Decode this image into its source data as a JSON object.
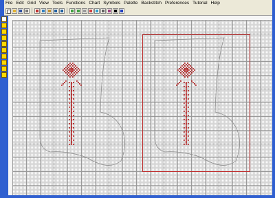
{
  "menu": [
    "File",
    "Edit",
    "Grid",
    "View",
    "Tools",
    "Functions",
    "Chart",
    "Symbols",
    "Palette",
    "Backstitch",
    "Preferences",
    "Tutorial",
    "Help"
  ],
  "toolbar": {
    "buttons": [
      "new-icon",
      "open-icon",
      "save-icon",
      "print-icon",
      "cut-icon",
      "copy-icon",
      "paste-icon",
      "undo-icon",
      "redo-icon",
      "zoom-in-icon",
      "zoom-out-icon",
      "grid-icon",
      "color-icon",
      "fill-icon",
      "select-icon",
      "backstitch-icon",
      "text-icon",
      "help-icon"
    ],
    "accent": "#2f5fd0"
  },
  "palette": {
    "tools": [
      "select-tool-icon",
      "pencil-tool-icon",
      "cross-stitch-tool-icon",
      "half-stitch-tool-icon",
      "backstitch-tool-icon",
      "fill-tool-icon",
      "eraser-tool-icon",
      "lasso-tool-icon",
      "magnifier-tool-icon",
      "color-picker-icon"
    ]
  },
  "colors": {
    "stitch": "#b22222",
    "outline": "#8c8c8c",
    "selection": "#c03030"
  }
}
